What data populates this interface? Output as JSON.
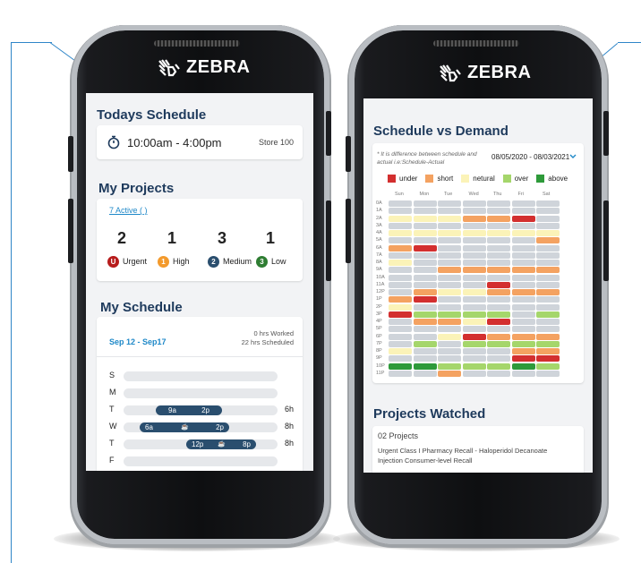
{
  "brand": "ZEBRA",
  "left": {
    "todays_schedule": {
      "title": "Todays Schedule",
      "time": "10:00am - 4:00pm",
      "store": "Store 100"
    },
    "projects": {
      "title": "My Projects",
      "active_link": "7 Active ( )",
      "stats": [
        {
          "count": "2",
          "badge": "U",
          "label": "Urgent",
          "color": "#b71c1c"
        },
        {
          "count": "1",
          "badge": "1",
          "label": "High",
          "color": "#f39a2c"
        },
        {
          "count": "3",
          "badge": "2",
          "label": "Medium",
          "color": "#2a4e6e"
        },
        {
          "count": "1",
          "badge": "3",
          "label": "Low",
          "color": "#2e7d32"
        }
      ]
    },
    "schedule": {
      "title": "My Schedule",
      "range": "Sep 12 - Sep17",
      "worked": "0 hrs Worked",
      "scheduled": "22 hrs Scheduled",
      "days": [
        {
          "day": "S",
          "hours": "",
          "start": "",
          "end": ""
        },
        {
          "day": "M",
          "hours": "",
          "start": "",
          "end": ""
        },
        {
          "day": "T",
          "hours": "6h",
          "start": "9a",
          "end": "2p"
        },
        {
          "day": "W",
          "hours": "8h",
          "start": "6a",
          "end": "2p"
        },
        {
          "day": "T",
          "hours": "8h",
          "start": "12p",
          "end": "8p"
        },
        {
          "day": "F",
          "hours": "",
          "start": "",
          "end": ""
        }
      ]
    }
  },
  "right": {
    "svd": {
      "title": "Schedule vs Demand",
      "note_line1": "* It is difference between schedule and",
      "note_line2": "actual i.e:Schedule-Actual",
      "date_range": "08/05/2020 - 08/03/2021",
      "legend": [
        {
          "label": "under",
          "color": "#d32f2f"
        },
        {
          "label": "short",
          "color": "#f4a261"
        },
        {
          "label": "netural",
          "color": "#fbf3b8"
        },
        {
          "label": "over",
          "color": "#a5d66b"
        },
        {
          "label": "above",
          "color": "#2e9a3a"
        }
      ],
      "days": [
        "Sun",
        "Mon",
        "Tue",
        "Wed",
        "Thu",
        "Fri",
        "Sat"
      ],
      "hours": [
        "0A",
        "1A",
        "2A",
        "3A",
        "4A",
        "5A",
        "6A",
        "7A",
        "8A",
        "9A",
        "10A",
        "11A",
        "12P",
        "1P",
        "2P",
        "3P",
        "4P",
        "5P",
        "6P",
        "7P",
        "8P",
        "9P",
        "10P",
        "11P"
      ],
      "grid": [
        "GGGGGGG",
        "GGGGGGG",
        "NNNSSUG",
        "GGGGGGG",
        "NNNNNNN",
        "GGGGGGS",
        "SUGGGGG",
        "GGGGGGG",
        "NGGGGGG",
        "GGSSSSS",
        "GGGGGGG",
        "GGGGUGG",
        "GSNNSSS",
        "SUGGGGG",
        "NGGGGGG",
        "UOOOOGO",
        "GSSNUGG",
        "GGGGGGG",
        "GGNUSSS",
        "GOGOOOO",
        "NGGGGSS",
        "GGGGGUU",
        "AAOOOAO",
        "GGSGGGG"
      ]
    },
    "watched": {
      "title": "Projects Watched",
      "count": "02 Projects",
      "item_line1": "Urgent Class I Pharmacy Recall - Haloperidol Decanoate",
      "item_line2": "Injection Consumer-level Recall"
    }
  }
}
